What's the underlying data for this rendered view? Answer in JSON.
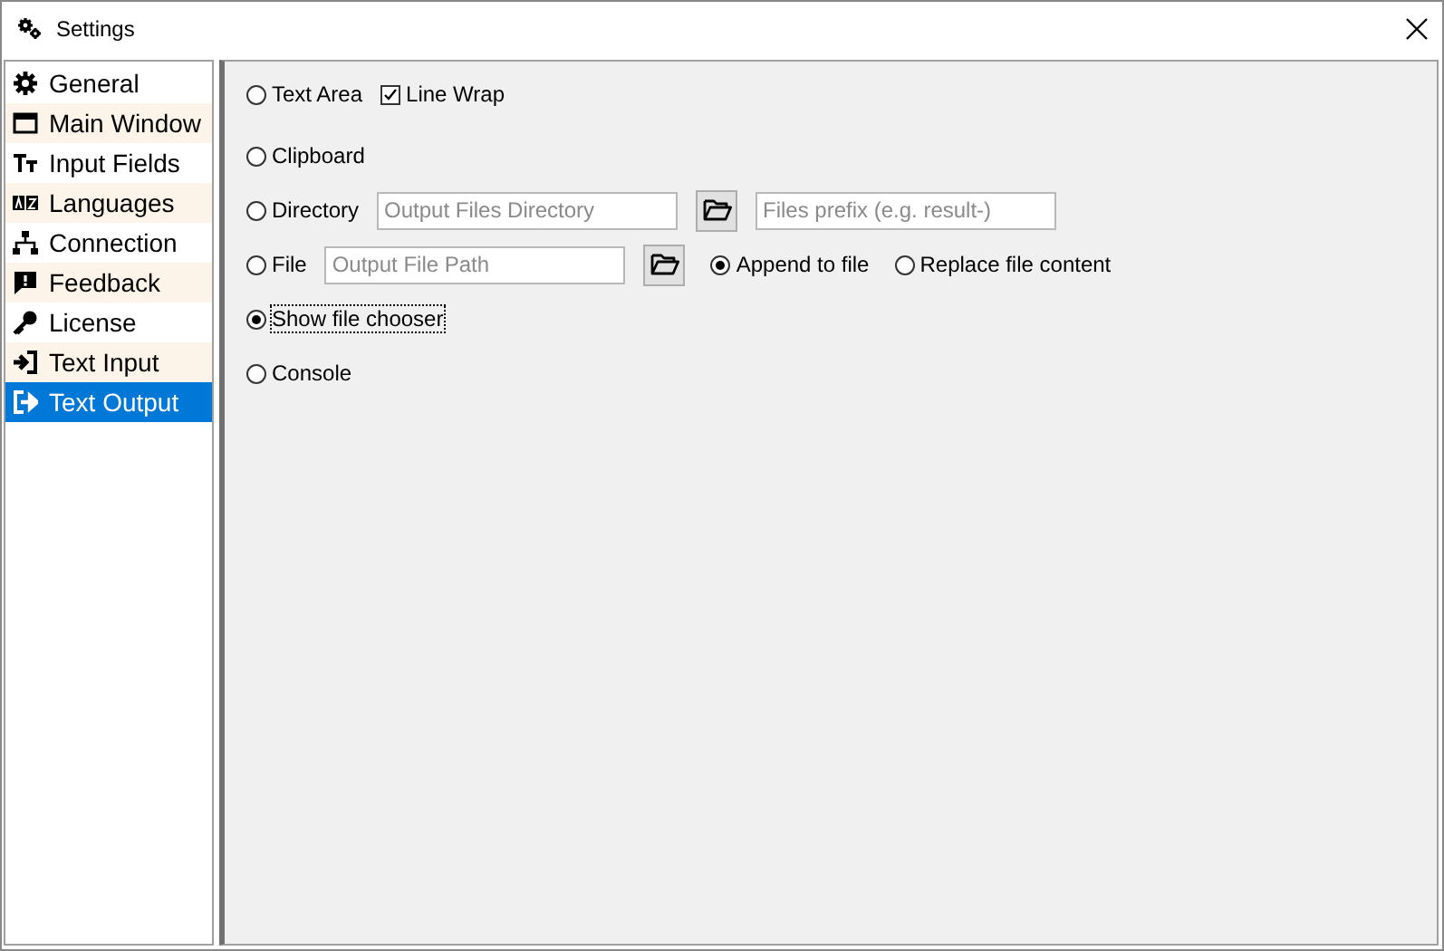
{
  "window": {
    "title": "Settings"
  },
  "sidebar": {
    "items": [
      {
        "label": "General",
        "selected": false
      },
      {
        "label": "Main Window",
        "selected": false
      },
      {
        "label": "Input Fields",
        "selected": false
      },
      {
        "label": "Languages",
        "selected": false
      },
      {
        "label": "Connection",
        "selected": false
      },
      {
        "label": "Feedback",
        "selected": false
      },
      {
        "label": "License",
        "selected": false
      },
      {
        "label": "Text Input",
        "selected": false
      },
      {
        "label": "Text Output",
        "selected": true
      }
    ]
  },
  "options": [
    {
      "label": "Text Area",
      "selected": false,
      "focused": false,
      "extras": [
        {
          "kind": "checkbox",
          "label": "Line Wrap",
          "checked": true
        }
      ]
    },
    {
      "label": "Clipboard",
      "selected": false,
      "focused": false
    },
    {
      "label": "Directory",
      "selected": false,
      "focused": false,
      "extras": [
        {
          "kind": "field",
          "placeholder": "Output Files Directory"
        },
        {
          "kind": "browse"
        },
        {
          "kind": "field",
          "placeholder": "Files prefix (e.g. result-)"
        }
      ]
    },
    {
      "label": "File",
      "selected": false,
      "focused": false,
      "extras": [
        {
          "kind": "field",
          "placeholder": "Output File Path"
        },
        {
          "kind": "browse"
        },
        {
          "kind": "radio",
          "label": "Append to file",
          "selected": true
        },
        {
          "kind": "radio",
          "label": "Replace file content",
          "selected": false
        }
      ]
    },
    {
      "label": "Show file chooser",
      "selected": true,
      "focused": true
    },
    {
      "label": "Console",
      "selected": false,
      "focused": false
    }
  ]
}
